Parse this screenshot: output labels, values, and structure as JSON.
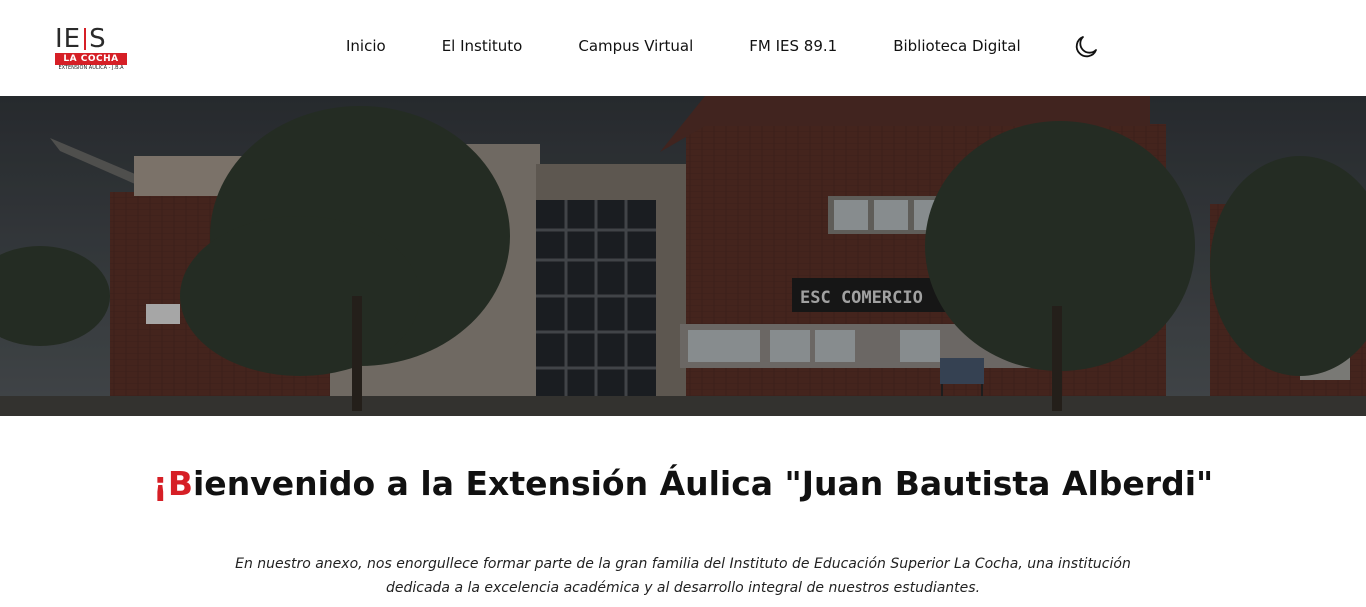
{
  "brand": {
    "logo_main_left": "IE",
    "logo_main_right": "S",
    "logo_band": "LA COCHA",
    "logo_sub": "EXTENSIÓN ÁULICA - J.B.A",
    "accent_color": "#d61f26"
  },
  "nav": {
    "items": [
      {
        "label": "Inicio"
      },
      {
        "label": "El Instituto"
      },
      {
        "label": "Campus Virtual"
      },
      {
        "label": "FM IES 89.1"
      },
      {
        "label": "Biblioteca Digital"
      }
    ],
    "theme_toggle_icon": "moon-icon"
  },
  "hero": {
    "image": "building-photo",
    "sign_text": "ESC COMERCIO"
  },
  "welcome": {
    "accent": "¡B",
    "rest": "ienvenido a la Extensión Áulica \"Juan Bautista Alberdi\""
  },
  "intro": {
    "text": "En nuestro anexo, nos enorgullece formar parte de la gran familia del Instituto de Educación Superior La Cocha, una institución dedicada a la excelencia académica y al desarrollo integral de nuestros estudiantes."
  }
}
